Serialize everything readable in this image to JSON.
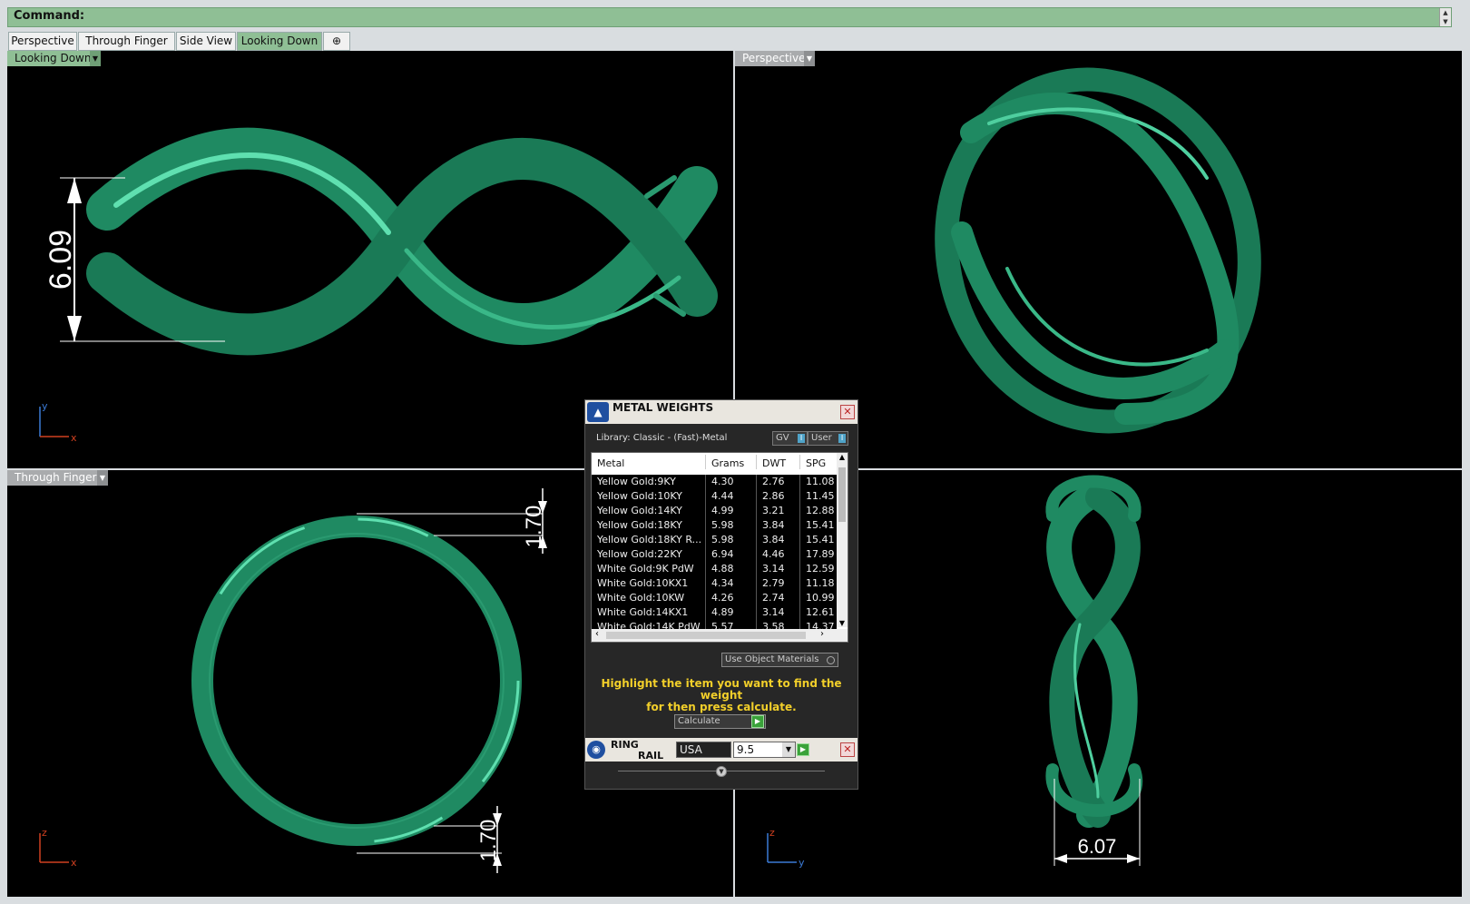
{
  "command": {
    "label": "Command:"
  },
  "tabs": [
    {
      "label": "Perspective",
      "active": false
    },
    {
      "label": "Through Finger",
      "active": false
    },
    {
      "label": "Side View",
      "active": false
    },
    {
      "label": "Looking Down",
      "active": true
    }
  ],
  "add_tab_icon": "plus-icon",
  "viewports": {
    "top_left": {
      "label": "Looking Down",
      "dimension": "6.09",
      "axes": {
        "vertical": "y",
        "horizontal": "x"
      }
    },
    "top_right": {
      "label": "Perspective"
    },
    "bottom_left": {
      "label": "Through Finger",
      "dimension_top": "1.70",
      "dimension_bottom": "1.70",
      "axes": {
        "vertical": "z",
        "horizontal": "x"
      }
    },
    "bottom_right": {
      "dimension": "6.07",
      "axes": {
        "vertical": "z",
        "horizontal": "y"
      }
    }
  },
  "dialog": {
    "title": "METAL WEIGHTS",
    "library": "Library: Classic - (Fast)-Metal",
    "toggle_gv": "GV",
    "toggle_user": "User",
    "columns": [
      "Metal",
      "Grams",
      "DWT",
      "SPG"
    ],
    "rows": [
      [
        "Yellow Gold:9KY",
        "4.30",
        "2.76",
        "11.08"
      ],
      [
        "Yellow Gold:10KY",
        "4.44",
        "2.86",
        "11.45"
      ],
      [
        "Yellow Gold:14KY",
        "4.99",
        "3.21",
        "12.88"
      ],
      [
        "Yellow Gold:18KY",
        "5.98",
        "3.84",
        "15.41"
      ],
      [
        "Yellow Gold:18KY R...",
        "5.98",
        "3.84",
        "15.41"
      ],
      [
        "Yellow Gold:22KY",
        "6.94",
        "4.46",
        "17.89"
      ],
      [
        "White Gold:9K PdW",
        "4.88",
        "3.14",
        "12.59"
      ],
      [
        "White Gold:10KX1",
        "4.34",
        "2.79",
        "11.18"
      ],
      [
        "White Gold:10KW",
        "4.26",
        "2.74",
        "10.99"
      ],
      [
        "White Gold:14KX1",
        "4.89",
        "3.14",
        "12.61"
      ],
      [
        "White Gold:14K PdW",
        "5.57",
        "3.58",
        "14.37"
      ]
    ],
    "use_object_materials": "Use Object Materials",
    "hint_line1": "Highlight the item you want to find the weight",
    "hint_line2": "for then press calculate.",
    "calculate": "Calculate",
    "ring_rail_1": "RING",
    "ring_rail_2": "RAIL",
    "country": "USA",
    "ring_size": "9.5"
  },
  "colors": {
    "ring_green": "#1f8a62",
    "ring_highlight": "#5fe0b0",
    "command_bar": "#8fbf95",
    "hint_text": "#f2cf2a"
  }
}
